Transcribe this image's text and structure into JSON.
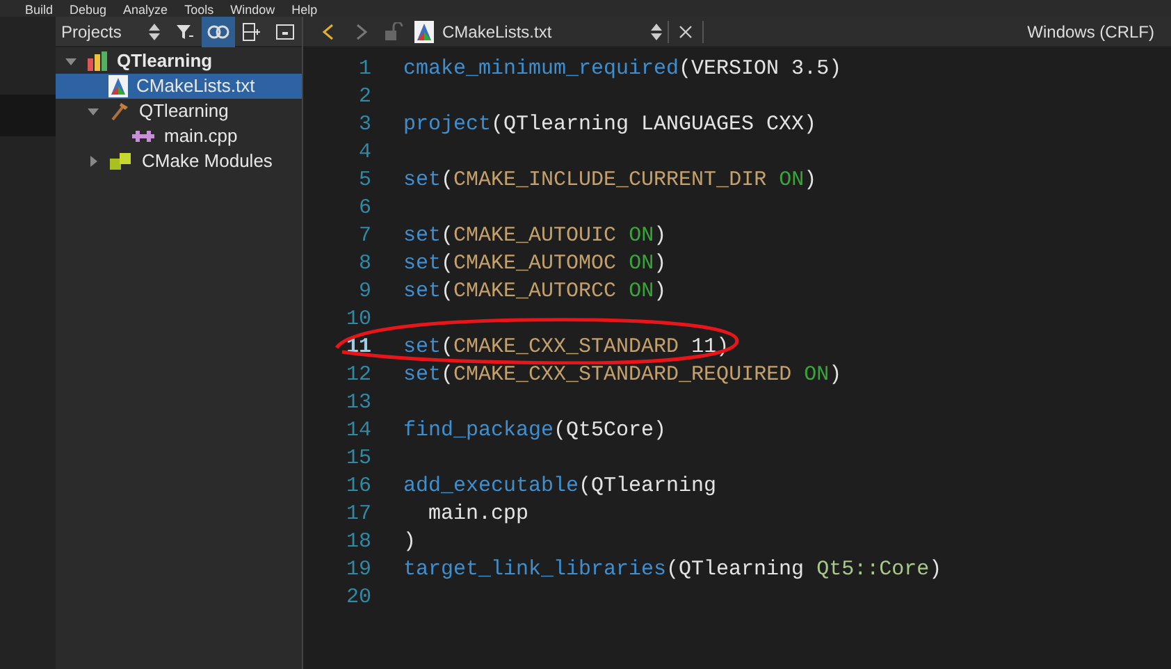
{
  "menu_bar": [
    "Build",
    "Debug",
    "Analyze",
    "Tools",
    "Window",
    "Help"
  ],
  "sidebar": {
    "title": "Projects",
    "tools": [
      {
        "kind": "filter",
        "selected": false
      },
      {
        "kind": "link",
        "selected": true
      },
      {
        "kind": "split",
        "selected": false
      },
      {
        "kind": "close",
        "selected": false
      }
    ],
    "tree": [
      {
        "label": "QTlearning",
        "kind": "project",
        "bold": true,
        "expanded": true,
        "selected": false,
        "children": [
          {
            "label": "CMakeLists.txt",
            "kind": "cmake",
            "selected": true,
            "bold": false
          },
          {
            "label": "QTlearning",
            "kind": "build",
            "bold": false,
            "expanded": true,
            "selected": false,
            "children": [
              {
                "label": "main.cpp",
                "kind": "cpp",
                "bold": false,
                "selected": false
              }
            ]
          },
          {
            "label": "CMake Modules",
            "kind": "modules",
            "bold": false,
            "expanded": false,
            "selected": false
          }
        ]
      }
    ]
  },
  "editor": {
    "back_enabled": true,
    "forward_enabled": false,
    "file_name": "CMakeLists.txt",
    "line_ending": "Windows (CRLF)",
    "lines": [
      {
        "number": "1",
        "current": false,
        "tokens": [
          {
            "kind": "func",
            "text": "cmake_minimum_required"
          },
          {
            "kind": "plain",
            "text": "(VERSION 3.5)"
          }
        ]
      },
      {
        "number": "2",
        "current": false
      },
      {
        "number": "3",
        "current": false,
        "tokens": [
          {
            "kind": "func",
            "text": "project"
          },
          {
            "kind": "plain",
            "text": "(QTlearning LANGUAGES CXX)"
          }
        ]
      },
      {
        "number": "4",
        "current": false
      },
      {
        "number": "5",
        "current": false,
        "tokens": [
          {
            "kind": "func",
            "text": "set"
          },
          {
            "kind": "plain",
            "text": "("
          },
          {
            "kind": "var",
            "text": "CMAKE_INCLUDE_CURRENT_DIR "
          },
          {
            "kind": "const",
            "text": "ON"
          },
          {
            "kind": "plain",
            "text": ")"
          }
        ]
      },
      {
        "number": "6",
        "current": false
      },
      {
        "number": "7",
        "current": false,
        "tokens": [
          {
            "kind": "func",
            "text": "set"
          },
          {
            "kind": "plain",
            "text": "("
          },
          {
            "kind": "var",
            "text": "CMAKE_AUTOUIC "
          },
          {
            "kind": "const",
            "text": "ON"
          },
          {
            "kind": "plain",
            "text": ")"
          }
        ]
      },
      {
        "number": "8",
        "current": false,
        "tokens": [
          {
            "kind": "func",
            "text": "set"
          },
          {
            "kind": "plain",
            "text": "("
          },
          {
            "kind": "var",
            "text": "CMAKE_AUTOMOC "
          },
          {
            "kind": "const",
            "text": "ON"
          },
          {
            "kind": "plain",
            "text": ")"
          }
        ]
      },
      {
        "number": "9",
        "current": false,
        "tokens": [
          {
            "kind": "func",
            "text": "set"
          },
          {
            "kind": "plain",
            "text": "("
          },
          {
            "kind": "var",
            "text": "CMAKE_AUTORCC "
          },
          {
            "kind": "const",
            "text": "ON"
          },
          {
            "kind": "plain",
            "text": ")"
          }
        ]
      },
      {
        "number": "10",
        "current": false
      },
      {
        "number": "11",
        "current": true,
        "circled": true,
        "tokens": [
          {
            "kind": "func",
            "text": "set"
          },
          {
            "kind": "plain",
            "text": "("
          },
          {
            "kind": "var",
            "text": "CMAKE_CXX_STANDARD "
          },
          {
            "kind": "plain",
            "text": "11)"
          }
        ]
      },
      {
        "number": "12",
        "current": false,
        "tokens": [
          {
            "kind": "func",
            "text": "set"
          },
          {
            "kind": "plain",
            "text": "("
          },
          {
            "kind": "var",
            "text": "CMAKE_CXX_STANDARD_REQUIRED "
          },
          {
            "kind": "const",
            "text": "ON"
          },
          {
            "kind": "plain",
            "text": ")"
          }
        ]
      },
      {
        "number": "13",
        "current": false
      },
      {
        "number": "14",
        "current": false,
        "tokens": [
          {
            "kind": "func",
            "text": "find_package"
          },
          {
            "kind": "plain",
            "text": "(Qt5Core)"
          }
        ]
      },
      {
        "number": "15",
        "current": false
      },
      {
        "number": "16",
        "current": false,
        "tokens": [
          {
            "kind": "func",
            "text": "add_executable"
          },
          {
            "kind": "plain",
            "text": "(QTlearning"
          }
        ]
      },
      {
        "number": "17",
        "current": false,
        "tokens": [
          {
            "kind": "plain",
            "text": "  main.cpp"
          }
        ]
      },
      {
        "number": "18",
        "current": false,
        "tokens": [
          {
            "kind": "plain",
            "text": ")"
          }
        ]
      },
      {
        "number": "19",
        "current": false,
        "tokens": [
          {
            "kind": "func",
            "text": "target_link_libraries"
          },
          {
            "kind": "plain",
            "text": "(QTlearning "
          },
          {
            "kind": "target",
            "text": "Qt5::Core"
          },
          {
            "kind": "plain",
            "text": ")"
          }
        ]
      },
      {
        "number": "20",
        "current": false
      }
    ]
  }
}
